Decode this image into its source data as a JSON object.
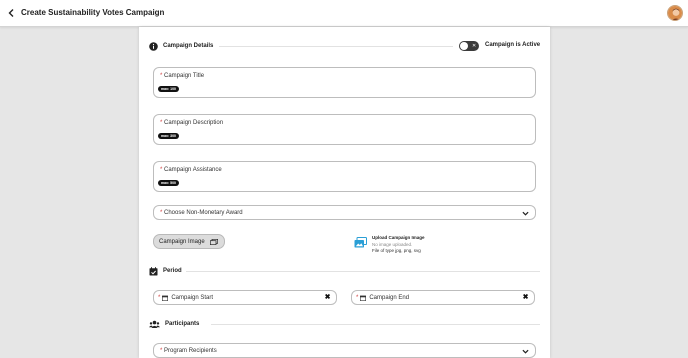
{
  "header": {
    "title": "Create Sustainability Votes Campaign",
    "back_icon": "chevron-left-icon",
    "avatar_icon": "user-avatar"
  },
  "campaign_details": {
    "section_label": "Campaign Details",
    "section_icon": "info-circle-icon",
    "active_toggle": {
      "label": "Campaign is Active",
      "state": "off"
    },
    "fields": [
      {
        "label": "Campaign Title",
        "required": "*",
        "max_badge": "max: 100"
      },
      {
        "label": "Campaign Description",
        "required": "*",
        "max_badge": "max: 300"
      },
      {
        "label": "Campaign Assistance",
        "required": "*",
        "max_badge": "max: 500"
      }
    ],
    "award_select": {
      "placeholder": "Choose Non-Monetary Award",
      "required": "*"
    },
    "campaign_image_button": "Campaign Image",
    "upload": {
      "title": "Upload Campaign Image",
      "status": "No image uploaded.",
      "types": "File of type jpg, png, svg"
    }
  },
  "period": {
    "section_label": "Period",
    "section_icon": "calendar-check-icon",
    "start": {
      "label": "Campaign Start",
      "required": "*"
    },
    "end": {
      "label": "Campaign End",
      "required": "*"
    }
  },
  "participants": {
    "section_label": "Participants",
    "section_icon": "users-icon",
    "recipients_select": {
      "placeholder": "Program Recipients",
      "required": "*"
    }
  },
  "colors": {
    "background": "#e6e6e6",
    "card": "#ffffff",
    "required": "#d13b3b",
    "toggle_off": "#3b3b3b",
    "upload_icon": "#2a9fd6"
  }
}
